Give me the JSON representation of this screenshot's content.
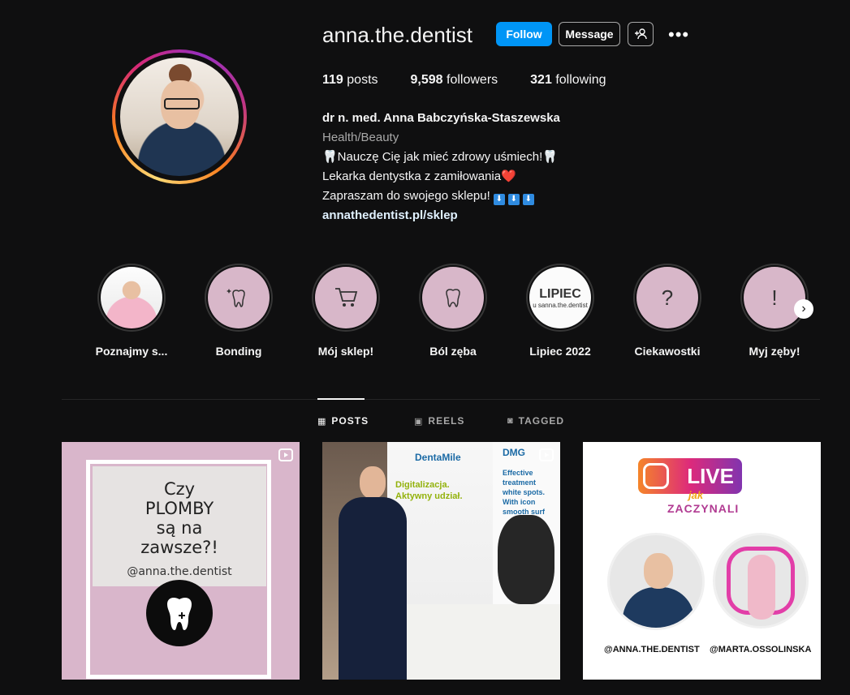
{
  "profile": {
    "username": "anna.the.dentist",
    "follow_label": "Follow",
    "message_label": "Message",
    "more_label": "•••",
    "stats": [
      {
        "value": "119",
        "label": "posts"
      },
      {
        "value": "9,598",
        "label": "followers"
      },
      {
        "value": "321",
        "label": "following"
      }
    ],
    "bio": {
      "name": "dr n. med. Anna Babczyńska-Staszewska",
      "category": "Health/Beauty",
      "line1": "🦷Nauczę Cię jak mieć zdrowy uśmiech!🦷",
      "line2": "Lekarka dentystka z zamiłowania❤️",
      "line3": "Zapraszam do swojego sklepu!",
      "link": "annathedentist.pl/sklep"
    }
  },
  "highlights": [
    {
      "label": "Poznajmy s...",
      "icon": "photo"
    },
    {
      "label": "Bonding",
      "icon": "sparkle-tooth"
    },
    {
      "label": "Mój sklep!",
      "icon": "cart"
    },
    {
      "label": "Ból zęba",
      "icon": "tooth"
    },
    {
      "label": "Lipiec 2022",
      "icon": "lipiec",
      "cover_title": "LIPIEC",
      "cover_sub": "u sanna.the.dentist"
    },
    {
      "label": "Ciekawostki",
      "icon": "question"
    },
    {
      "label": "Myj zęby!",
      "icon": "exclamation"
    }
  ],
  "tabs": [
    {
      "label": "POSTS",
      "active": true
    },
    {
      "label": "REELS",
      "active": false
    },
    {
      "label": "TAGGED",
      "active": false
    }
  ],
  "posts": {
    "p1": {
      "title_lines": [
        "Czy",
        "PLOMBY",
        "są na",
        "zawsze?!"
      ],
      "handle": "@anna.the.dentist"
    },
    "p2": {
      "brand1": "DentaMile",
      "brand2": "DMG",
      "text1": "Digitalizacja.",
      "text2": "Aktywny udział.",
      "side_text1": "Effective treatment",
      "side_text2": "white spots.",
      "side_text3": "With icon smooth surf"
    },
    "p3": {
      "live": "LIVE",
      "jak": "jak",
      "sub": "ZACZYNALI",
      "handle1": "@ANNA.THE.DENTIST",
      "handle2": "@MARTA.OSSOLINSKA"
    }
  },
  "colors": {
    "accent": "#0095f6",
    "highlight_bg": "#d8b7c9",
    "background": "#0f0f10"
  }
}
